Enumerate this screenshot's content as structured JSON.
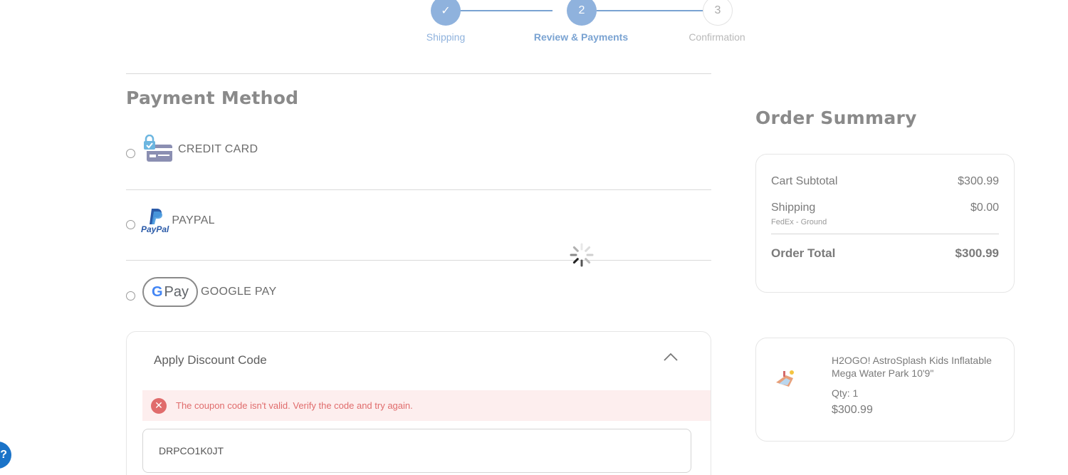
{
  "stepper": {
    "steps": [
      {
        "number": "✓",
        "label": "Shipping"
      },
      {
        "number": "2",
        "label": "Review & Payments"
      },
      {
        "number": "3",
        "label": "Confirmation"
      }
    ]
  },
  "payment": {
    "title": "Payment Method",
    "methods": [
      {
        "label": "CREDIT CARD",
        "icon": "credit-card-lock-icon"
      },
      {
        "label": "PAYPAL",
        "icon": "paypal-icon",
        "brand_text": "PayPal"
      },
      {
        "label": "GOOGLE PAY",
        "icon": "google-pay-icon",
        "brand_text": "Pay"
      }
    ]
  },
  "discount": {
    "title": "Apply Discount Code",
    "error": "The coupon code isn't valid. Verify the code and try again.",
    "code_value": "DRPCO1K0JT"
  },
  "summary": {
    "title": "Order Summary",
    "subtotal_label": "Cart Subtotal",
    "subtotal_value": "$300.99",
    "shipping_label": "Shipping",
    "shipping_value": "$0.00",
    "shipping_method": "FedEx - Ground",
    "total_label": "Order Total",
    "total_value": "$300.99"
  },
  "item": {
    "name": "H2OGO! AstroSplash Kids Inflatable Mega Water Park 10'9\"",
    "qty": "Qty: 1",
    "price": "$300.99"
  },
  "colors": {
    "accent": "#8fb2dd",
    "error": "#e06c6c",
    "chat": "#1a73c8"
  }
}
